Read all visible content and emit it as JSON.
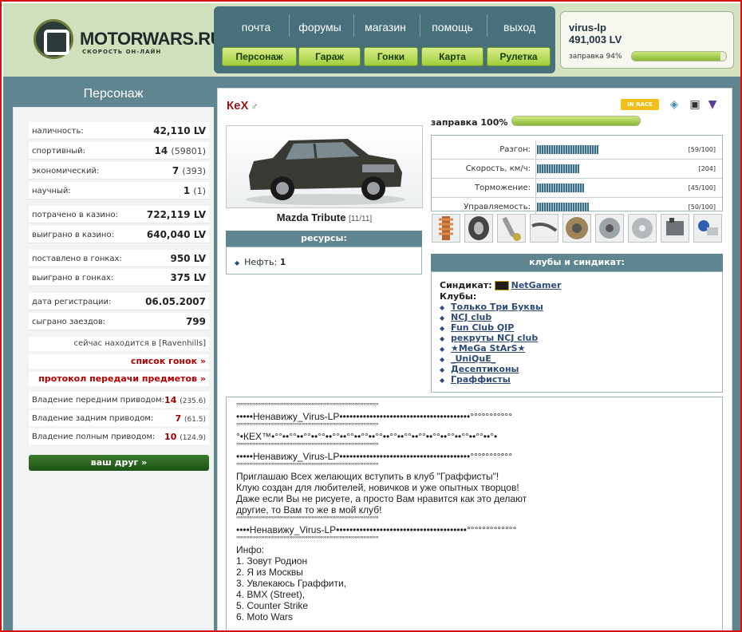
{
  "header": {
    "logo_title": "MOTORWARS.RU",
    "logo_subtitle": "СКОРОСТЬ ОН-ЛАЙН",
    "top_nav": [
      "почта",
      "форумы",
      "магазин",
      "помощь",
      "выход"
    ],
    "buttons": [
      "Персонаж",
      "Гараж",
      "Гонки",
      "Карта",
      "Рулетка"
    ]
  },
  "user": {
    "name": "virus-lp",
    "balance": "491,003 LV",
    "fuel_label": "заправка 94%",
    "fuel_fraction": 0.94
  },
  "sidebar": {
    "title": "Персонаж",
    "stats": [
      {
        "label": "наличность:",
        "value": "42,110 LV",
        "sub": ""
      },
      {
        "label": "спортивный:",
        "value": "14",
        "sub": "(59801)"
      },
      {
        "label": "экономический:",
        "value": "7",
        "sub": "(393)"
      },
      {
        "label": "научный:",
        "value": "1",
        "sub": "(1)"
      },
      {
        "label": "потрачено в казино:",
        "value": "722,119 LV",
        "sub": ""
      },
      {
        "label": "выиграно в казино:",
        "value": "640,040 LV",
        "sub": ""
      },
      {
        "label": "поставлено в гонках:",
        "value": "950 LV",
        "sub": ""
      },
      {
        "label": "выиграно в гонках:",
        "value": "375 LV",
        "sub": ""
      },
      {
        "label": "дата регистрации:",
        "value": "06.05.2007",
        "sub": ""
      },
      {
        "label": "сыграно заездов:",
        "value": "799",
        "sub": ""
      }
    ],
    "location": "сейчас находится в [Ravenhills]",
    "race_list_link": "список гонок »",
    "transfer_link": "протокол передачи предметов »",
    "ownership": [
      {
        "label": "Владение передним приводом:",
        "value": "14",
        "sub": "(235.6)"
      },
      {
        "label": "Владение задним приводом:",
        "value": "7",
        "sub": "(61.5)"
      },
      {
        "label": "Владение полным приводом:",
        "value": "10",
        "sub": "(124.9)"
      }
    ],
    "friend_button": "ваш друг »"
  },
  "profile": {
    "name": "КеХ",
    "gender_symbol": "♂",
    "in_race_badge": "IN RACE",
    "car_name": "Mazda Tribute",
    "car_count": "[11/11]",
    "fuel_label": "заправка 100%",
    "fuel_fraction": 1.0,
    "resources_header": "ресурсы:",
    "resource_item_label": "Нефть:",
    "resource_item_value": "1",
    "performance": [
      {
        "label": "Разгон:",
        "value": "[59/100]",
        "fraction": 0.59
      },
      {
        "label": "Скорость, км/ч:",
        "value": "[204]",
        "fraction": 0.41
      },
      {
        "label": "Торможение:",
        "value": "[45/100]",
        "fraction": 0.45
      },
      {
        "label": "Управляемость:",
        "value": "[50/100]",
        "fraction": 0.5
      }
    ],
    "parts": [
      "suspension",
      "tire",
      "exhaust",
      "pipe",
      "brake-disc",
      "turbo",
      "disk",
      "engine-block",
      "intake"
    ],
    "clubs_header": "клубы и синдикат:",
    "syndicate_label": "Синдикат:",
    "syndicate_name": "NetGamer",
    "clubs_label": "Клубы:",
    "clubs": [
      "Только Три Буквы",
      "NCJ club",
      "Fun Club QIP",
      "рекруты NCJ club",
      "★MeGa StArS★",
      "_UniQuE_",
      "Десептиконы",
      "Граффисты"
    ]
  },
  "description": [
    {
      "text": "°°°°°°°°°°°°°°°°°°°°°°°°°°°°°°°°°°°°°°°°°°°°°°°°°°°°°°°°°°°°°°°°°°",
      "dots": true
    },
    {
      "text": "•••••Ненавижу_Virus-LP•••••••••••••••••••••••••••••••••••••••°°°°°°°°°°°",
      "dots": false
    },
    {
      "text": "°°°°°°°°°°°°°°°°°°°°°°°°°°°°°°°°°°°°°°°°°°°°°°°°°°°°°°°°°°°°°°°°°°",
      "dots": true
    },
    {
      "text": "°•КЕХ™•°°••°°••°°••°°••°°••°°••°°••°°••°°••°°••°°••°°••°°••°°••°°••°•",
      "dots": false
    },
    {
      "text": "°°°°°°°°°°°°°°°°°°°°°°°°°°°°°°°°°°°°°°°°°°°°°°°°°°°°°°°°°°°°°°°°°°",
      "dots": true
    },
    {
      "text": "•••••Ненавижу_Virus-LP•••••••••••••••••••••••••••••••••••••••°°°°°°°°°°°",
      "dots": false
    },
    {
      "text": "°°°°°°°°°°°°°°°°°°°°°°°°°°°°°°°°°°°°°°°°°°°°°°°°°°°°°°°°°°°°°°°°°°",
      "dots": true
    },
    {
      "text": "Приглашаю Всех желающих вступить в клуб \"Граффисты\"!",
      "dots": false
    },
    {
      "text": "Клую создан для любителей, новичков и уже опытных творцов!",
      "dots": false
    },
    {
      "text": "Даже если Вы не рисуете, а просто Вам нравится как это делают",
      "dots": false
    },
    {
      "text": "другие, то Вам то же в мой клуб!",
      "dots": false
    },
    {
      "text": "°°°°°°°°°°°°°°°°°°°°°°°°°°°°°°°°°°°°°°°°°°°°°°°°°°°°°°°°°°°°°°°°°°",
      "dots": true
    },
    {
      "text": "••••Ненавижу_Virus-LP•••••••••••••••••••••••••••••••••••••••°°°°°°°°°°°°°",
      "dots": false
    },
    {
      "text": "°°°°°°°°°°°°°°°°°°°°°°°°°°°°°°°°°°°°°°°°°°°°°°°°°°°°°°°°°°°°°°°°°°",
      "dots": true
    },
    {
      "text": "Инфо:",
      "dots": false
    },
    {
      "text": "1. Зовут Родион",
      "dots": false
    },
    {
      "text": "2. Я из Москвы",
      "dots": false
    },
    {
      "text": "3. Увлекаюсь Граффити,",
      "dots": false
    },
    {
      "text": "4. BMX (Street),",
      "dots": false
    },
    {
      "text": "5. Counter Strike",
      "dots": false
    },
    {
      "text": "6. Moto Wars",
      "dots": false
    }
  ]
}
